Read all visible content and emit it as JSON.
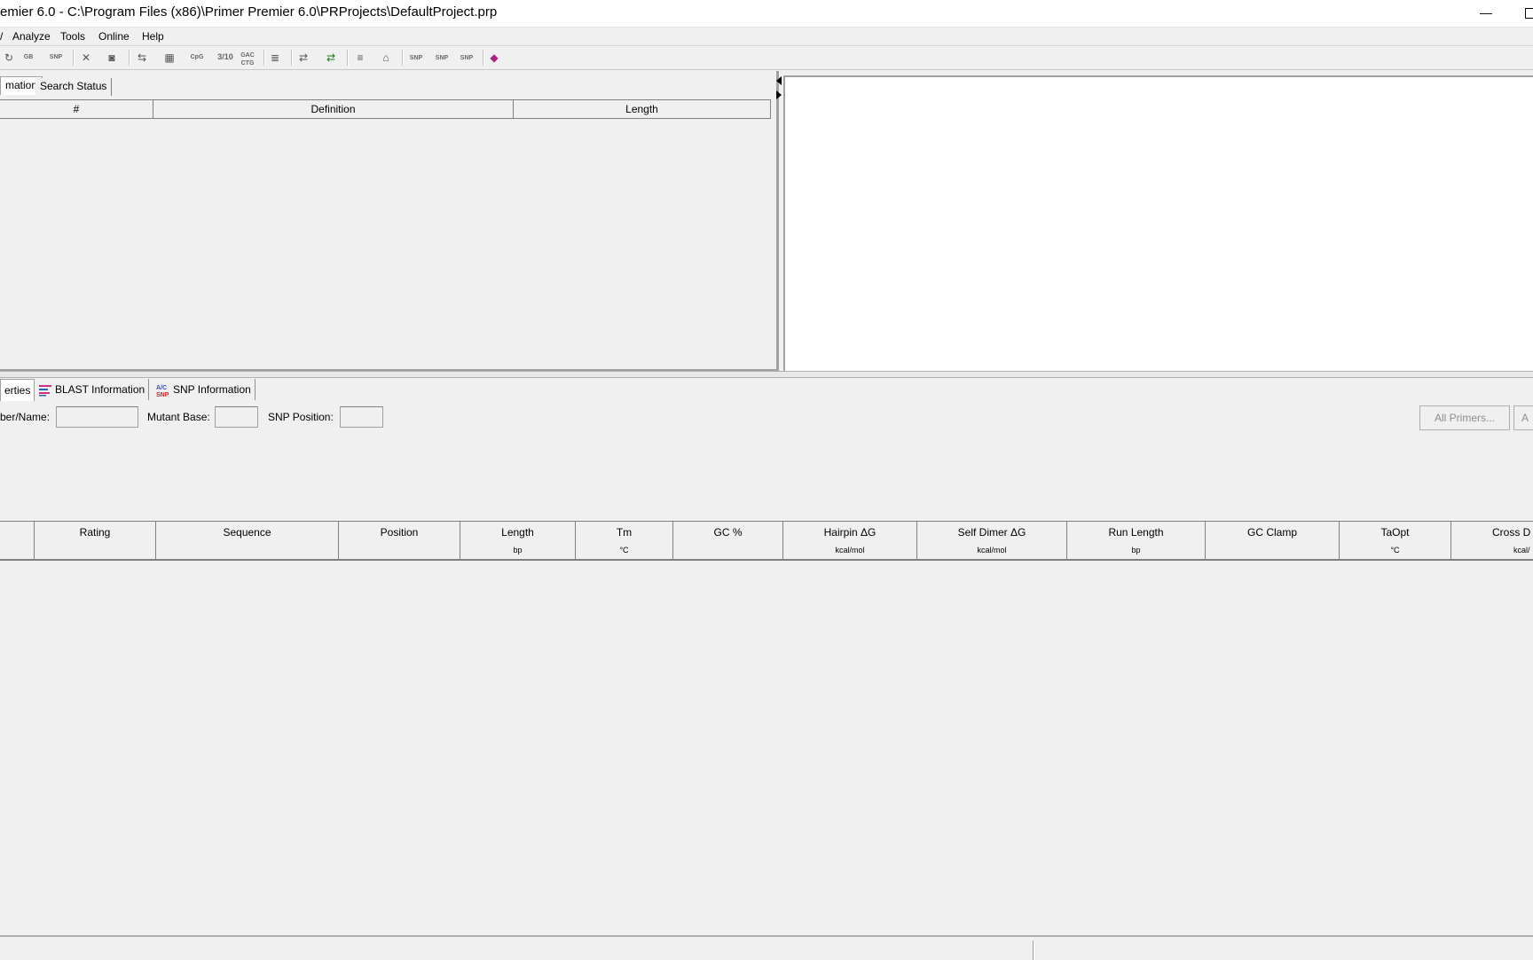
{
  "window": {
    "title": "emier 6.0 - C:\\Program Files (x86)\\Primer Premier 6.0\\PRProjects\\DefaultProject.prp",
    "minimize_glyph": "—"
  },
  "menu": {
    "items": [
      {
        "label": "/"
      },
      {
        "label": "Analyze"
      },
      {
        "label": "Tools"
      },
      {
        "label": "Online"
      },
      {
        "label": "Help"
      }
    ]
  },
  "toolbar": {
    "icons": [
      {
        "name": "open-genbank-icon",
        "glyph": "↻",
        "color": "#2e8b2e"
      },
      {
        "name": "gb-icon",
        "glyph": "GB",
        "color": "#1e5aa8"
      },
      {
        "name": "snp-globe-icon",
        "glyph": "SNP",
        "color": "#c03030"
      },
      {
        "name": "delete-icon",
        "glyph": "✕",
        "color": "#555555"
      },
      {
        "name": "binoculars-icon",
        "glyph": "◙",
        "color": "#555555"
      },
      {
        "name": "swap-icon",
        "glyph": "⇆",
        "color": "#555555"
      },
      {
        "name": "grid-icon",
        "glyph": "▦",
        "color": "#555555"
      },
      {
        "name": "cpg-icon",
        "glyph": "CpG",
        "color": "#777777"
      },
      {
        "name": "ratio-icon",
        "glyph": "3/10",
        "color": "#777777"
      },
      {
        "name": "gac-ctg-icon",
        "glyph": "GAC CTG",
        "color": "#777777"
      },
      {
        "name": "align-icon",
        "glyph": "≣",
        "color": "#555555"
      },
      {
        "name": "arrows-icon",
        "glyph": "⇄",
        "color": "#555555"
      },
      {
        "name": "arrows-color-icon",
        "glyph": "⇄",
        "color": "#1a7a1a"
      },
      {
        "name": "text-align-icon",
        "glyph": "≡",
        "color": "#555555"
      },
      {
        "name": "stamp-icon",
        "glyph": "⌂",
        "color": "#555555"
      },
      {
        "name": "snp-dot-icon",
        "glyph": "SNP",
        "color": "#777777"
      },
      {
        "name": "snp-delete-icon",
        "glyph": "SNP",
        "color": "#777777"
      },
      {
        "name": "snp-check-icon",
        "glyph": "SNP",
        "color": "#777777"
      },
      {
        "name": "help-book-icon",
        "glyph": "◆",
        "color": "#b02080"
      }
    ]
  },
  "upper_left": {
    "tabs": [
      {
        "label": "mation"
      },
      {
        "label": "Search Status"
      }
    ],
    "columns": [
      {
        "label": "#"
      },
      {
        "label": "Definition"
      },
      {
        "label": "Length"
      }
    ]
  },
  "lower": {
    "tabs": [
      {
        "label": "erties"
      },
      {
        "label": "BLAST Information"
      },
      {
        "label": "SNP Information"
      }
    ],
    "filters": {
      "name_label": "ber/Name:",
      "name_value": "",
      "mutant_label": "Mutant Base:",
      "mutant_value": "",
      "snp_pos_label": "SNP Position:",
      "snp_pos_value": ""
    },
    "buttons": {
      "all_primers": "All Primers...",
      "next": "A"
    },
    "columns": [
      {
        "label": "",
        "unit": ""
      },
      {
        "label": "Rating",
        "unit": ""
      },
      {
        "label": "Sequence",
        "unit": ""
      },
      {
        "label": "Position",
        "unit": ""
      },
      {
        "label": "Length",
        "unit": "bp"
      },
      {
        "label": "Tm",
        "unit": "°C"
      },
      {
        "label": "GC %",
        "unit": ""
      },
      {
        "label": "Hairpin ΔG",
        "unit": "kcal/mol"
      },
      {
        "label": "Self Dimer ΔG",
        "unit": "kcal/mol"
      },
      {
        "label": "Run Length",
        "unit": "bp"
      },
      {
        "label": "GC Clamp",
        "unit": ""
      },
      {
        "label": "TaOpt",
        "unit": "°C"
      },
      {
        "label": "Cross D",
        "unit": "kcal/"
      }
    ]
  }
}
